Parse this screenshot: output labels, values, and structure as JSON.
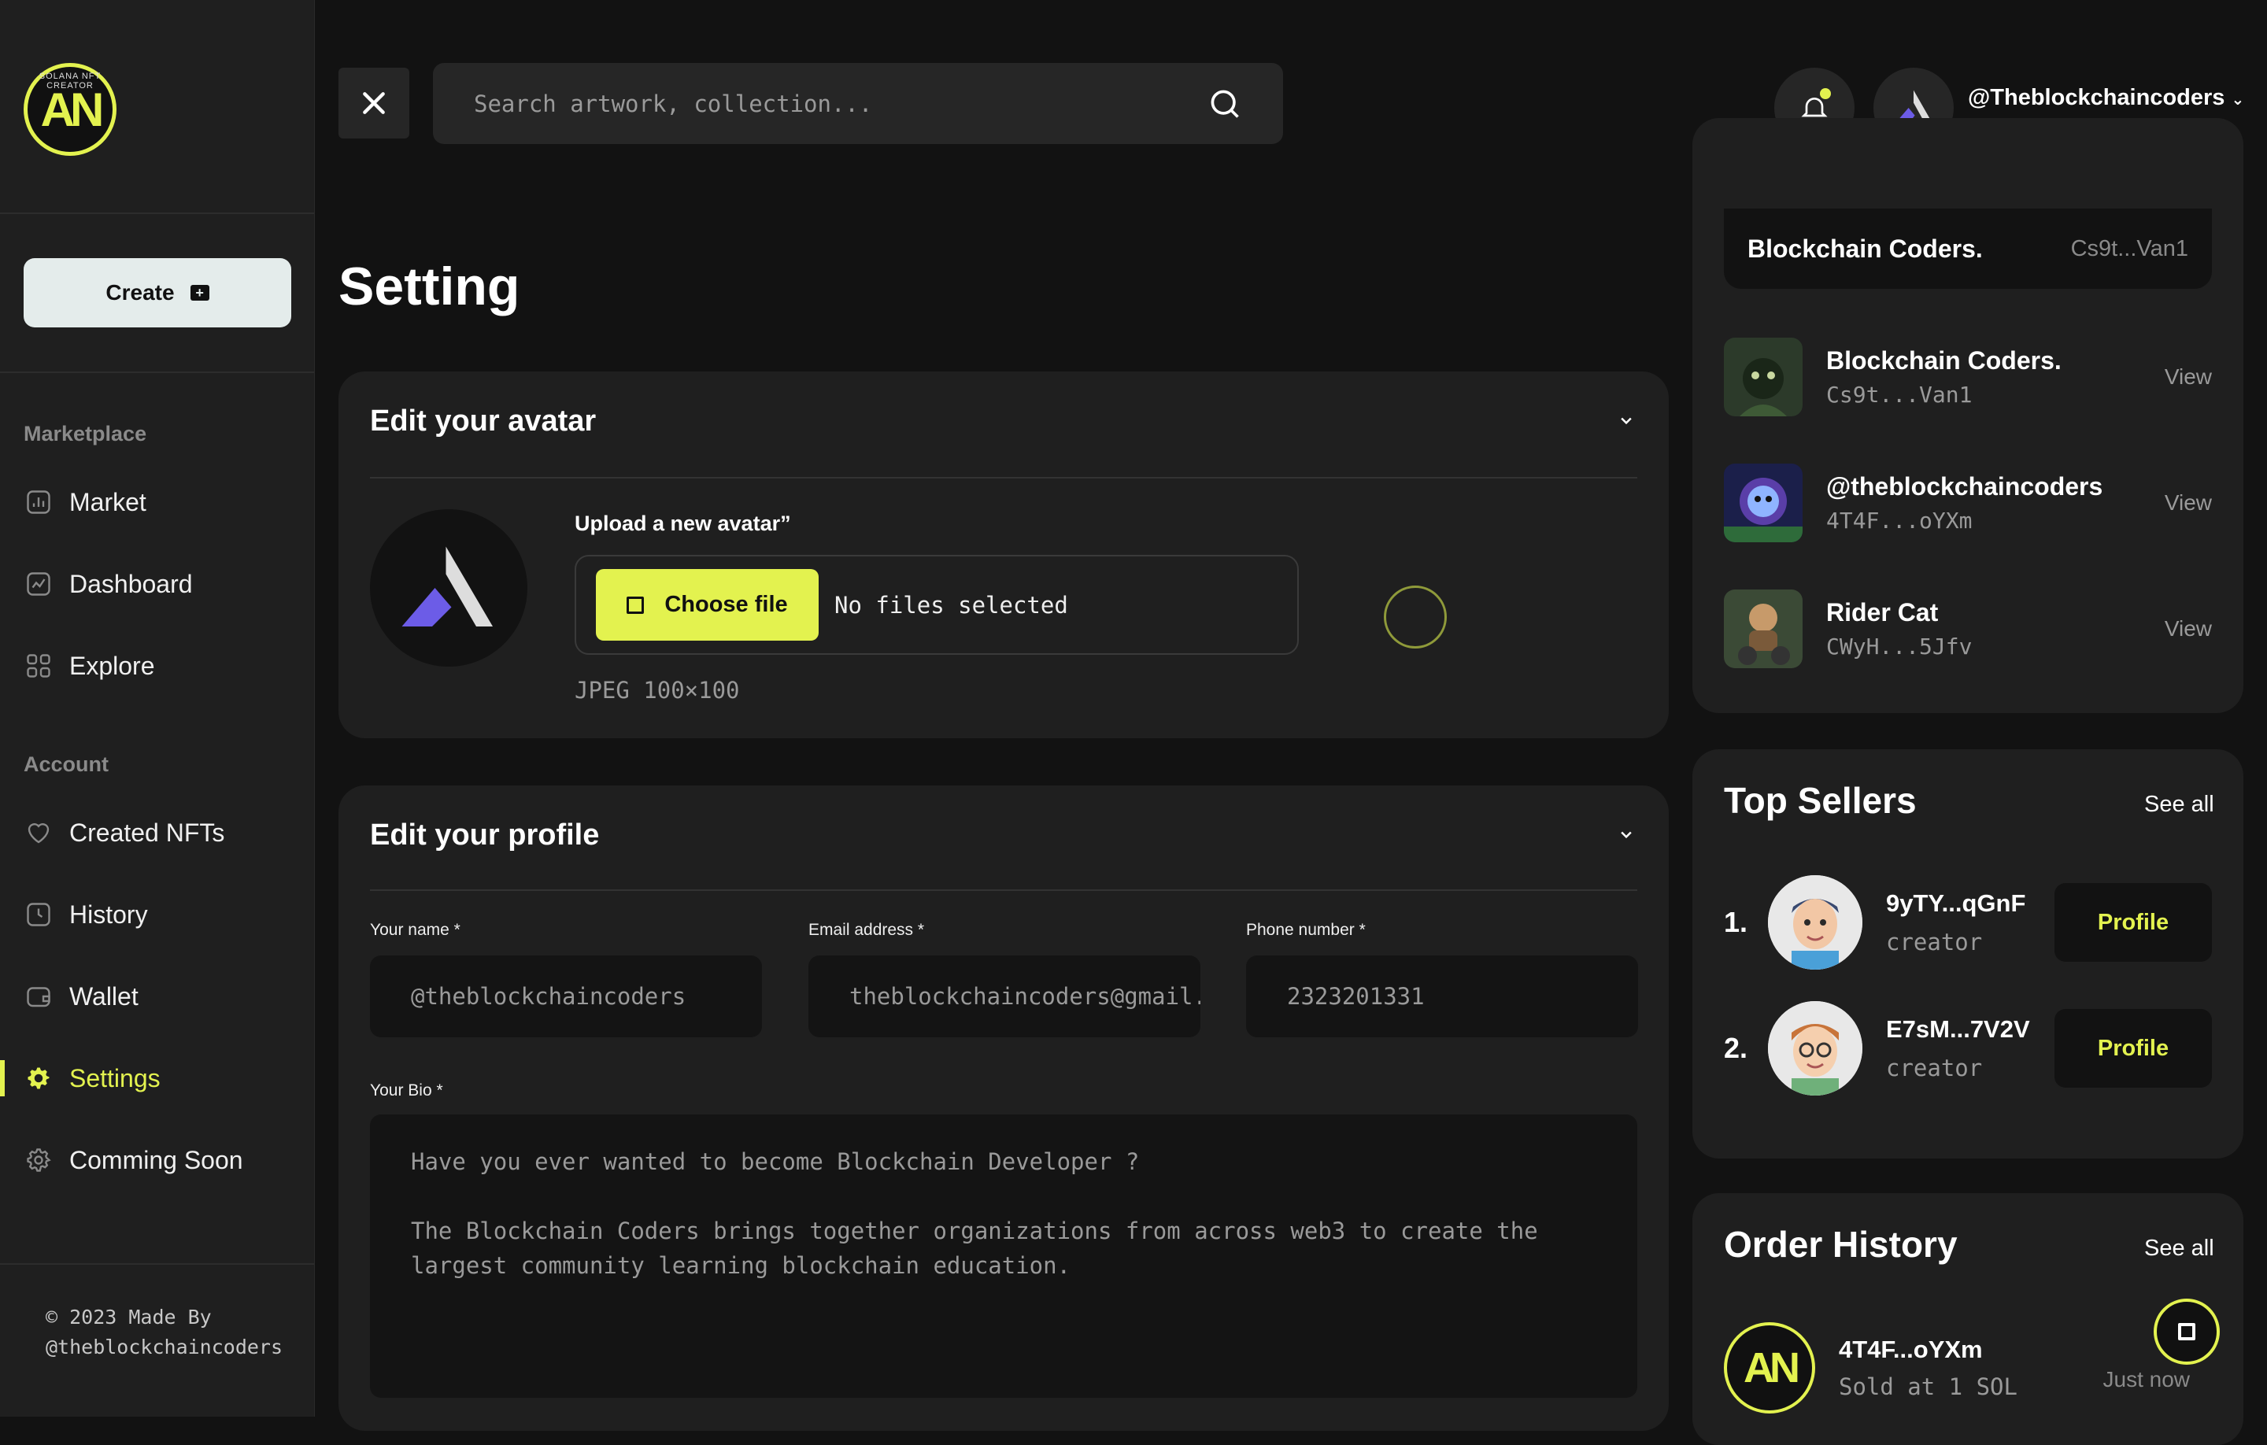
{
  "sidebar": {
    "logo_text": "AN",
    "logo_ring": "SOLANA NFT CREATOR",
    "create_label": "Create",
    "marketplace_heading": "Marketplace",
    "account_heading": "Account",
    "items": [
      {
        "label": "Market",
        "icon": "chart-bar-icon"
      },
      {
        "label": "Dashboard",
        "icon": "chart-line-icon"
      },
      {
        "label": "Explore",
        "icon": "grid-icon"
      },
      {
        "label": "Created NFTs",
        "icon": "heart-icon"
      },
      {
        "label": "History",
        "icon": "clock-icon"
      },
      {
        "label": "Wallet",
        "icon": "wallet-icon"
      },
      {
        "label": "Settings",
        "icon": "gear-icon",
        "active": true
      },
      {
        "label": "Comming Soon",
        "icon": "gear-outline-icon"
      }
    ],
    "footer_line1": "© 2023 Made By",
    "footer_line2": "@theblockchaincoders"
  },
  "topbar": {
    "search_placeholder": "Search artwork, collection...",
    "username": "@Theblockchaincoders"
  },
  "main": {
    "title": "Setting",
    "avatar_card": {
      "heading": "Edit your avatar",
      "upload_label": "Upload a new avatar”",
      "choose_file": "Choose file",
      "no_files": "No files selected",
      "hint": "JPEG 100×100"
    },
    "profile_card": {
      "heading": "Edit your profile",
      "name_label": "Your name *",
      "name_value": "@theblockchaincoders",
      "email_label": "Email address *",
      "email_value": "theblockchaincoders@gmail.com",
      "phone_label": "Phone number *",
      "phone_value": "2323201331",
      "bio_label": "Your Bio *",
      "bio_value": "Have you ever wanted to become Blockchain Developer ?\n\nThe Blockchain Coders brings together organizations from across web3 to create the\nlargest community learning blockchain education."
    }
  },
  "right": {
    "featured": {
      "name": "Blockchain Coders.",
      "addr": "Cs9t...Van1"
    },
    "collections": [
      {
        "name": "Blockchain Coders.",
        "addr": "Cs9t...Van1",
        "action": "View"
      },
      {
        "name": "@theblockchaincoders",
        "addr": "4T4F...oYXm",
        "action": "View"
      },
      {
        "name": "Rider Cat",
        "addr": "CWyH...5Jfv",
        "action": "View"
      }
    ],
    "top_sellers": {
      "title": "Top Sellers",
      "see_all": "See all",
      "items": [
        {
          "rank": "1.",
          "addr": "9yTY...qGnF",
          "role": "creator",
          "action": "Profile"
        },
        {
          "rank": "2.",
          "addr": "E7sM...7V2V",
          "role": "creator",
          "action": "Profile"
        }
      ]
    },
    "order_history": {
      "title": "Order History",
      "see_all": "See all",
      "items": [
        {
          "addr": "4T4F...oYXm",
          "sub": "Sold at 1 SOL",
          "time": "Just now"
        }
      ]
    }
  },
  "colors": {
    "accent": "#e3f24f",
    "background": "#121212",
    "panel": "#1f1f1f"
  }
}
